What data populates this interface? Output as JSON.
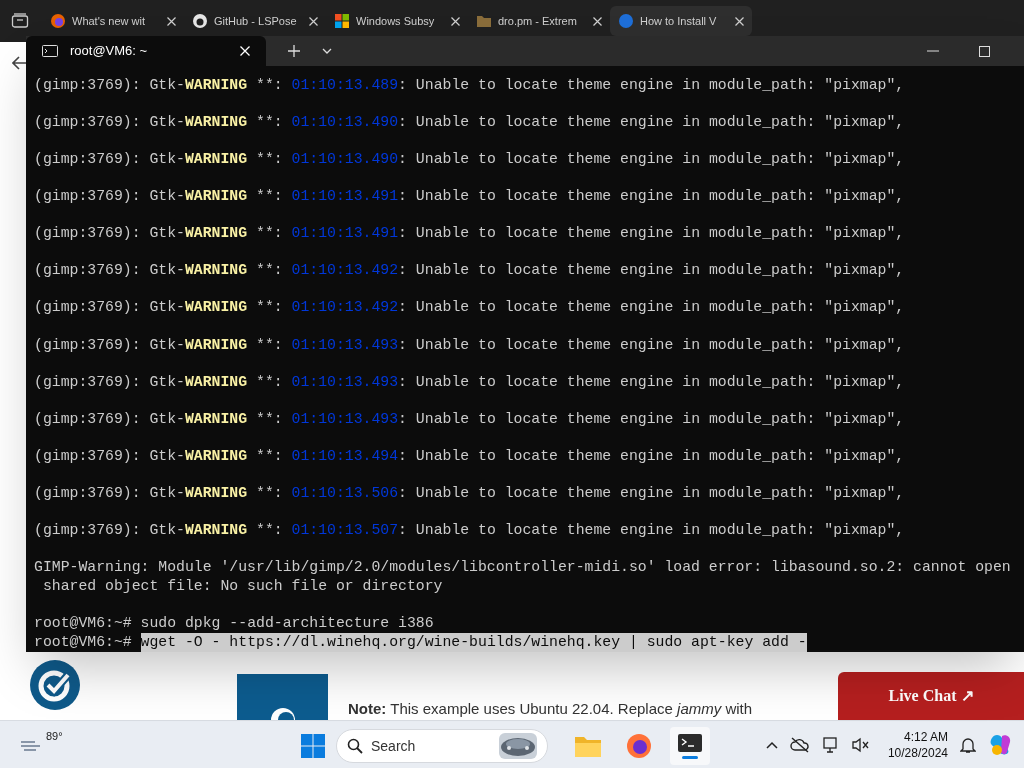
{
  "browser": {
    "tabs": [
      {
        "title": "What's new wit",
        "selected": false
      },
      {
        "title": "GitHub - LSPose",
        "selected": false
      },
      {
        "title": "Windows Subsy",
        "selected": false
      },
      {
        "title": "dro.pm - Extrem",
        "selected": false
      },
      {
        "title": "How to Install V",
        "selected": true
      }
    ]
  },
  "terminal": {
    "title": "root@VM6: ~",
    "lines": [
      {
        "kind": "log",
        "source": "(gimp:3769): Gtk-",
        "level": "WARNING",
        "stars": "**:",
        "time": "01:10:13.489",
        "message": ": Unable to locate theme engine in module_path: \"pixmap\","
      },
      {
        "kind": "log",
        "source": "(gimp:3769): Gtk-",
        "level": "WARNING",
        "stars": "**:",
        "time": "01:10:13.490",
        "message": ": Unable to locate theme engine in module_path: \"pixmap\","
      },
      {
        "kind": "log",
        "source": "(gimp:3769): Gtk-",
        "level": "WARNING",
        "stars": "**:",
        "time": "01:10:13.490",
        "message": ": Unable to locate theme engine in module_path: \"pixmap\","
      },
      {
        "kind": "log",
        "source": "(gimp:3769): Gtk-",
        "level": "WARNING",
        "stars": "**:",
        "time": "01:10:13.491",
        "message": ": Unable to locate theme engine in module_path: \"pixmap\","
      },
      {
        "kind": "log",
        "source": "(gimp:3769): Gtk-",
        "level": "WARNING",
        "stars": "**:",
        "time": "01:10:13.491",
        "message": ": Unable to locate theme engine in module_path: \"pixmap\","
      },
      {
        "kind": "log",
        "source": "(gimp:3769): Gtk-",
        "level": "WARNING",
        "stars": "**:",
        "time": "01:10:13.492",
        "message": ": Unable to locate theme engine in module_path: \"pixmap\","
      },
      {
        "kind": "log",
        "source": "(gimp:3769): Gtk-",
        "level": "WARNING",
        "stars": "**:",
        "time": "01:10:13.492",
        "message": ": Unable to locate theme engine in module_path: \"pixmap\","
      },
      {
        "kind": "log",
        "source": "(gimp:3769): Gtk-",
        "level": "WARNING",
        "stars": "**:",
        "time": "01:10:13.493",
        "message": ": Unable to locate theme engine in module_path: \"pixmap\","
      },
      {
        "kind": "log",
        "source": "(gimp:3769): Gtk-",
        "level": "WARNING",
        "stars": "**:",
        "time": "01:10:13.493",
        "message": ": Unable to locate theme engine in module_path: \"pixmap\","
      },
      {
        "kind": "log",
        "source": "(gimp:3769): Gtk-",
        "level": "WARNING",
        "stars": "**:",
        "time": "01:10:13.493",
        "message": ": Unable to locate theme engine in module_path: \"pixmap\","
      },
      {
        "kind": "log",
        "source": "(gimp:3769): Gtk-",
        "level": "WARNING",
        "stars": "**:",
        "time": "01:10:13.494",
        "message": ": Unable to locate theme engine in module_path: \"pixmap\","
      },
      {
        "kind": "log",
        "source": "(gimp:3769): Gtk-",
        "level": "WARNING",
        "stars": "**:",
        "time": "01:10:13.506",
        "message": ": Unable to locate theme engine in module_path: \"pixmap\","
      },
      {
        "kind": "log",
        "source": "(gimp:3769): Gtk-",
        "level": "WARNING",
        "stars": "**:",
        "time": "01:10:13.507",
        "message": ": Unable to locate theme engine in module_path: \"pixmap\","
      },
      {
        "kind": "plain",
        "text": "GIMP-Warning: Module '/usr/lib/gimp/2.0/modules/libcontroller-midi.so' load error: libasound.so.2: cannot open"
      },
      {
        "kind": "plain",
        "text": " shared object file: No such file or directory"
      },
      {
        "kind": "blank"
      },
      {
        "kind": "prompt",
        "prompt": "root@VM6:~#",
        "command": "sudo dpkg --add-architecture i386",
        "selected": false
      },
      {
        "kind": "prompt",
        "prompt": "root@VM6:~#",
        "command": "wget -O - https://dl.winehq.org/wine-builds/winehq.key | sudo apt-key add -",
        "selected": true
      }
    ]
  },
  "page": {
    "note": "**Note:** This example uses Ubuntu 22.04. Replace *jammy* with",
    "chat_button": "Live Chat ↗"
  },
  "taskbar": {
    "weather": "89°",
    "search_placeholder": "Search",
    "time": "4:12 AM",
    "date": "10/28/2024"
  }
}
